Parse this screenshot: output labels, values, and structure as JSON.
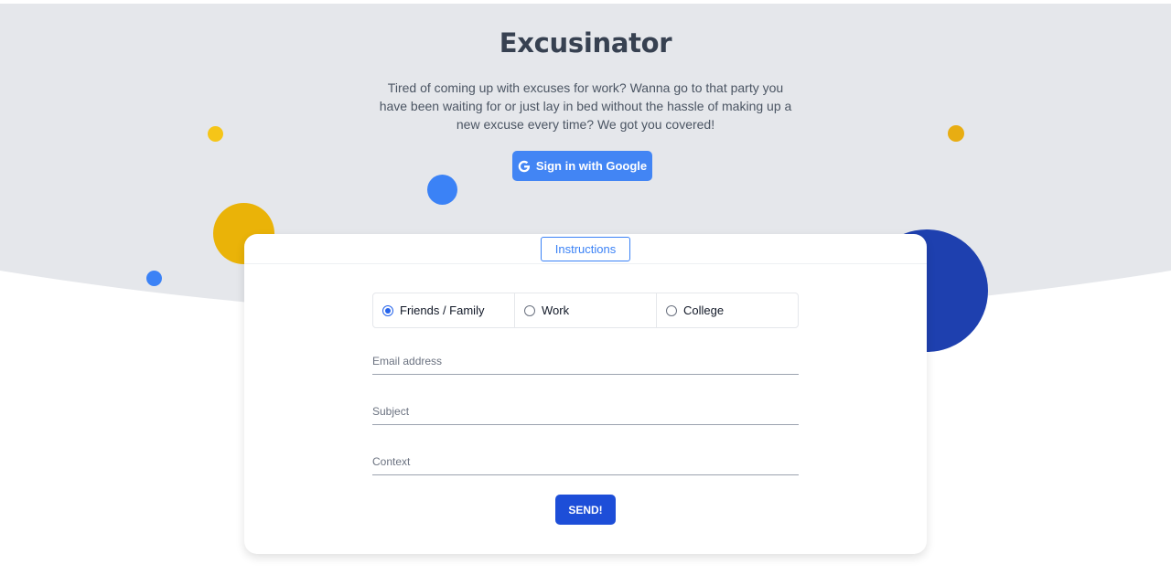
{
  "header": {
    "title": "Excusinator",
    "subtitle": "Tired of coming up with excuses for work? Wanna go to that party you have been waiting for or just lay in bed without the hassle of making up a new excuse every time? We got you covered!",
    "google_button_label": "Sign in with Google"
  },
  "card": {
    "instructions_label": "Instructions",
    "categories": [
      {
        "label": "Friends / Family",
        "selected": true
      },
      {
        "label": "Work",
        "selected": false
      },
      {
        "label": "College",
        "selected": false
      }
    ],
    "fields": {
      "email_placeholder": "Email address",
      "subject_placeholder": "Subject",
      "context_placeholder": "Context"
    },
    "send_label": "SEND!"
  },
  "colors": {
    "hero_bg": "#e5e7eb",
    "google_blue": "#4285f4",
    "send_blue": "#1d4ed8",
    "dot_yellow": "#eab308",
    "dot_blue": "#3b82f6",
    "dot_navy": "#1e40af"
  },
  "icons": {
    "google": "google-g-icon"
  }
}
